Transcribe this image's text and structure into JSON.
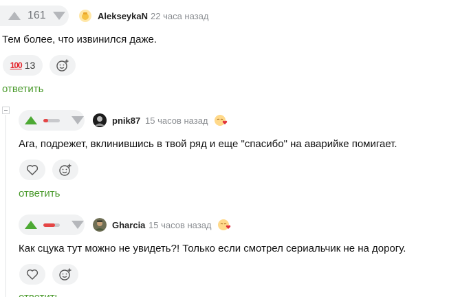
{
  "comments": [
    {
      "votes": "161",
      "username": "AlekseykaN",
      "time": "22 часа назад",
      "text": "Тем более, что извинился даже.",
      "reaction_count": "13",
      "reply": "ответить"
    },
    {
      "username": "pnik87",
      "time": "15 часов назад",
      "text": "Ага, подрежет, вклинившись в твой ряд и еще \"спасибо\" на аварийке помигает.",
      "reply": "ответить"
    },
    {
      "username": "Gharcia",
      "time": "15 часов назад",
      "text": "Как сцука тут можно не увидеть?! Только если смотрел сериальчик не на дорогу.",
      "reply": "ответить"
    }
  ],
  "colors": {
    "accent": "#4a9a2c",
    "upvote": "#4da934",
    "downvote": "#e54545"
  },
  "icons": [
    "upvote-icon",
    "downvote-icon",
    "hundred-emoji-icon",
    "add-reaction-icon",
    "heart-icon",
    "smug-emoji-icon",
    "love-emoji-icon"
  ]
}
